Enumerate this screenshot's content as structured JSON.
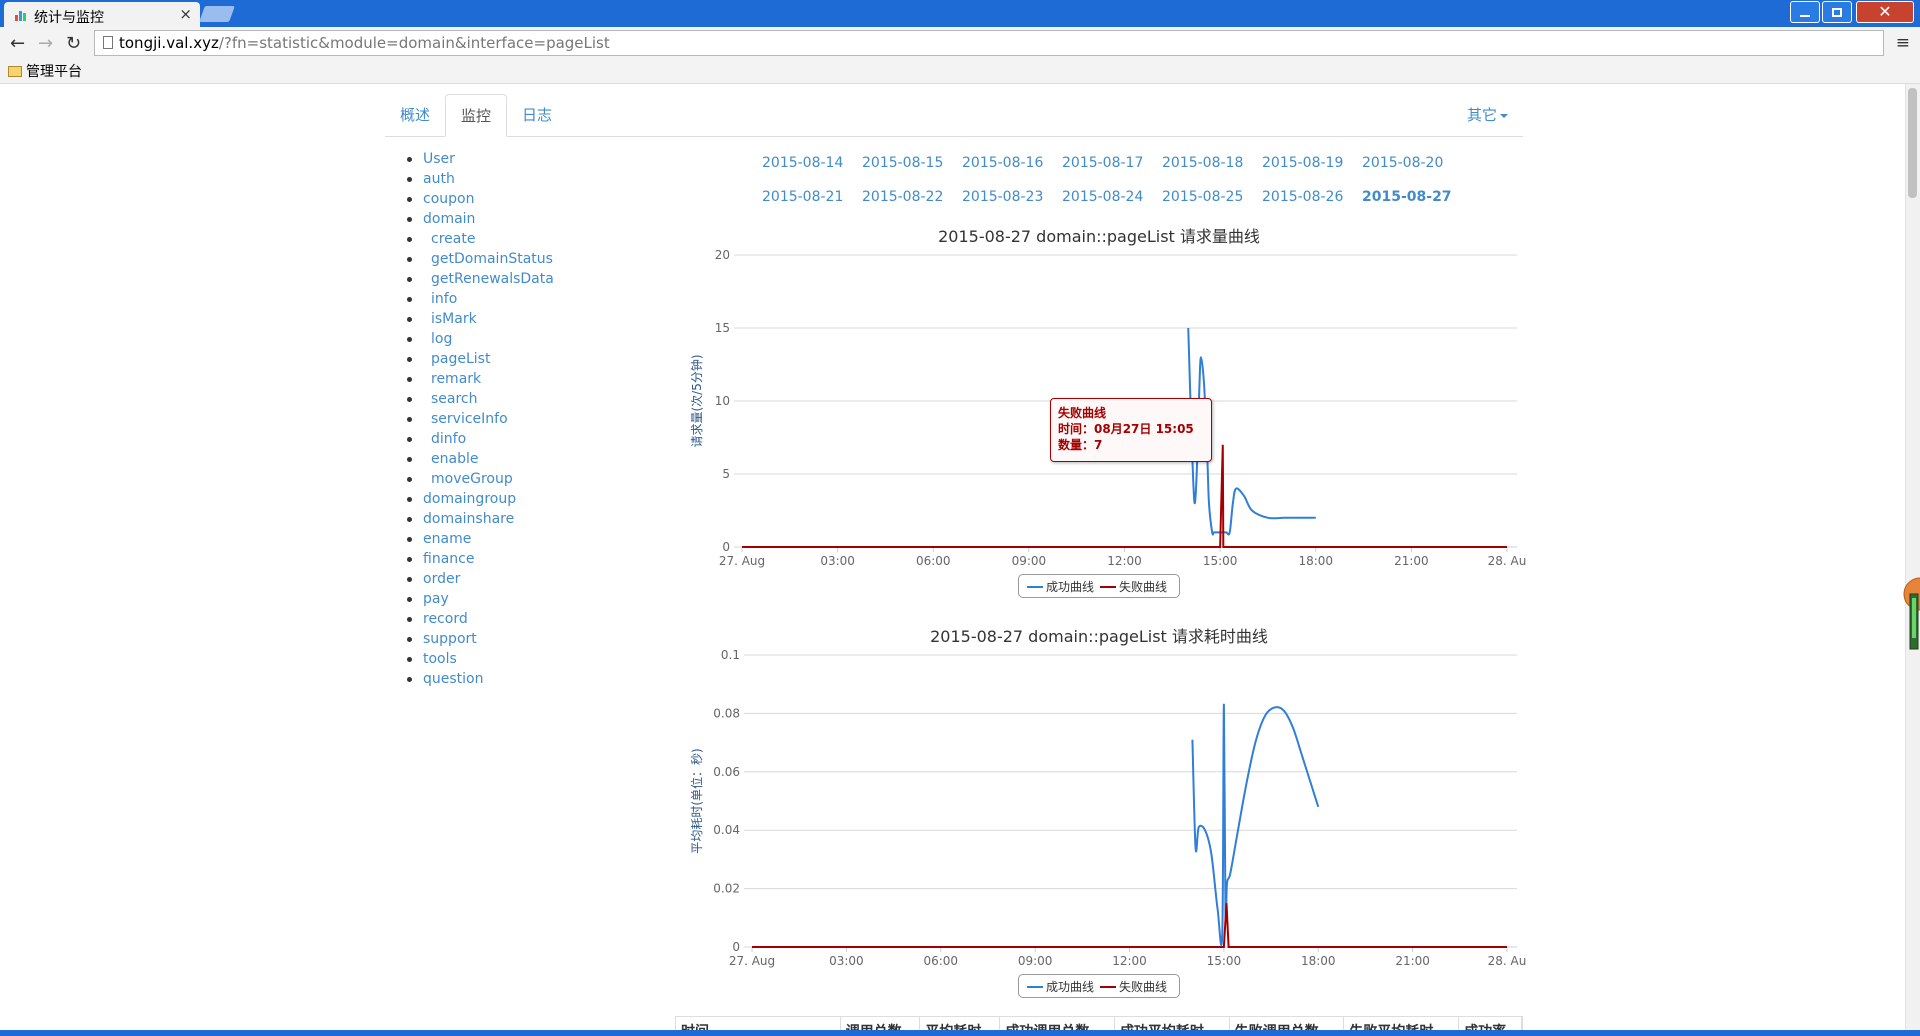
{
  "browser": {
    "tab_title": "统计与监控",
    "tab_close": "×",
    "url_host": "tongji.val.xyz",
    "url_path": "/?fn=statistic&module=domain&interface=pageList",
    "bookmark_label": "管理平台",
    "back_glyph": "←",
    "forward_glyph": "→",
    "reload_glyph": "↻",
    "menu_glyph": "≡"
  },
  "nav": {
    "tabs": [
      {
        "label": "概述"
      },
      {
        "label": "监控",
        "active": true
      },
      {
        "label": "日志"
      }
    ],
    "other_label": "其它"
  },
  "sidebar": {
    "items": [
      {
        "label": "User"
      },
      {
        "label": "auth"
      },
      {
        "label": "coupon"
      },
      {
        "label": "domain"
      },
      {
        "label": "create",
        "sub": true
      },
      {
        "label": "getDomainStatus",
        "sub": true
      },
      {
        "label": "getRenewalsData",
        "sub": true
      },
      {
        "label": "info",
        "sub": true
      },
      {
        "label": "isMark",
        "sub": true
      },
      {
        "label": "log",
        "sub": true
      },
      {
        "label": "pageList",
        "sub": true
      },
      {
        "label": "remark",
        "sub": true
      },
      {
        "label": "search",
        "sub": true
      },
      {
        "label": "serviceInfo",
        "sub": true
      },
      {
        "label": "dinfo",
        "sub": true
      },
      {
        "label": "enable",
        "sub": true
      },
      {
        "label": "moveGroup",
        "sub": true
      },
      {
        "label": "domaingroup"
      },
      {
        "label": "domainshare"
      },
      {
        "label": "ename"
      },
      {
        "label": "finance"
      },
      {
        "label": "order"
      },
      {
        "label": "pay"
      },
      {
        "label": "record"
      },
      {
        "label": "support"
      },
      {
        "label": "tools"
      },
      {
        "label": "question"
      }
    ]
  },
  "dates": {
    "row1": [
      "2015-08-14",
      "2015-08-15",
      "2015-08-16",
      "2015-08-17",
      "2015-08-18",
      "2015-08-19",
      "2015-08-20"
    ],
    "row2": [
      "2015-08-21",
      "2015-08-22",
      "2015-08-23",
      "2015-08-24",
      "2015-08-25",
      "2015-08-26",
      "2015-08-27"
    ],
    "active": "2015-08-27"
  },
  "colors": {
    "success": "#2f7ed8",
    "failure": "#a40000",
    "link": "#428bca"
  },
  "tooltip": {
    "series": "失败曲线",
    "time_label": "时间：08月27日 15:05",
    "count_label": "数量：7"
  },
  "chart_data": [
    {
      "type": "line",
      "title": "2015-08-27 domain::pageList 请求量曲线",
      "ylabel": "请求量(次/5分钟)",
      "xlabel": "",
      "ylim": [
        0,
        20
      ],
      "yticks": [
        "0",
        "5",
        "10",
        "15",
        "20"
      ],
      "xticks": [
        "27. Aug",
        "03:00",
        "06:00",
        "09:00",
        "12:00",
        "15:00",
        "18:00",
        "21:00",
        "28. Au"
      ],
      "grid": true,
      "legend": "bottom-center",
      "series": [
        {
          "name": "成功曲线",
          "x": [
            14.0,
            14.1,
            14.2,
            14.3,
            14.35,
            14.4,
            14.5,
            14.6,
            14.65,
            14.75,
            14.8,
            14.85,
            14.9,
            15.0,
            15.05,
            15.1,
            15.15,
            15.2,
            15.3,
            15.4,
            15.5,
            15.75,
            16.0,
            16.5,
            17.0,
            17.5,
            18.0
          ],
          "values": [
            15,
            8,
            3,
            7,
            11,
            13,
            11,
            6,
            3,
            1,
            1,
            1,
            1,
            1,
            1,
            1,
            1,
            1,
            1,
            3,
            4,
            3.5,
            2.5,
            2,
            2,
            2,
            2
          ]
        },
        {
          "name": "失败曲线",
          "x": [
            0,
            14.8,
            14.9,
            15.0,
            15.0833,
            15.1,
            15.2,
            24
          ],
          "values": [
            0,
            0,
            0,
            0,
            7,
            0,
            0,
            0
          ]
        }
      ]
    },
    {
      "type": "line",
      "title": "2015-08-27 domain::pageList 请求耗时曲线",
      "ylabel": "平均耗时(单位：秒)",
      "xlabel": "",
      "ylim": [
        0,
        0.1
      ],
      "yticks": [
        "0",
        "0.02",
        "0.04",
        "0.06",
        "0.08",
        "0.1"
      ],
      "xticks": [
        "27. Aug",
        "03:00",
        "06:00",
        "09:00",
        "12:00",
        "15:00",
        "18:00",
        "21:00",
        "28. Au"
      ],
      "grid": true,
      "legend": "bottom-center",
      "series": [
        {
          "name": "成功曲线",
          "x": [
            14.0,
            14.1,
            14.2,
            14.4,
            14.6,
            14.8,
            14.95,
            15.0,
            15.05,
            15.1,
            15.2,
            15.4,
            15.7,
            16.0,
            16.3,
            16.6,
            16.9,
            17.2,
            17.5,
            18.0
          ],
          "values": [
            0.071,
            0.034,
            0.041,
            0.04,
            0.032,
            0.013,
            0.005,
            0.083,
            0.012,
            0.022,
            0.025,
            0.037,
            0.055,
            0.07,
            0.079,
            0.082,
            0.081,
            0.075,
            0.065,
            0.048
          ]
        },
        {
          "name": "失败曲线",
          "x": [
            0,
            14.9,
            15.0,
            15.0833,
            15.15,
            15.2,
            24
          ],
          "values": [
            0,
            0,
            0,
            0.015,
            0,
            0,
            0
          ]
        }
      ]
    }
  ],
  "table": {
    "headers": [
      "时间",
      "调用总数",
      "平均耗时",
      "成功调用总数",
      "成功平均耗时",
      "失败调用总数",
      "失败平均耗时",
      "成功率"
    ]
  }
}
